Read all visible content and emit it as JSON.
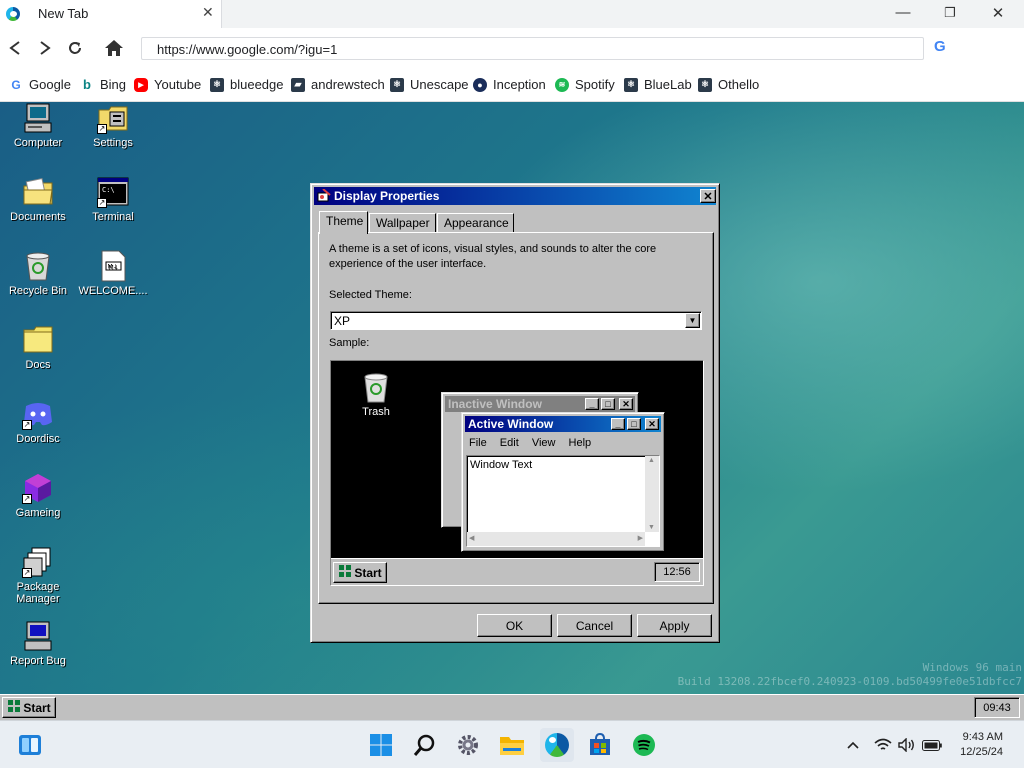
{
  "browser": {
    "tab_title": "New Tab",
    "tab_close": "✕",
    "minimize": "—",
    "restore": "❐",
    "close": "✕",
    "url": "https://www.google.com/?igu=1",
    "google_g": "G",
    "bookmarks": [
      {
        "label": "Google",
        "icon": "google-icon",
        "color": "#4285f4"
      },
      {
        "label": "Bing",
        "icon": "bing-icon",
        "color": "#0c8484"
      },
      {
        "label": "Youtube",
        "icon": "youtube-icon",
        "color": "#ff0000"
      },
      {
        "label": "blueedge",
        "icon": "blueedge-icon",
        "color": "#2b3a4a"
      },
      {
        "label": "andrewstech",
        "icon": "andrewstech-icon",
        "color": "#2b3a4a"
      },
      {
        "label": "Unescape",
        "icon": "unescape-icon",
        "color": "#2b3a4a"
      },
      {
        "label": "Inception",
        "icon": "inception-icon",
        "color": "#1a2d5a"
      },
      {
        "label": "Spotify",
        "icon": "spotify-icon",
        "color": "#1db954"
      },
      {
        "label": "BlueLab",
        "icon": "bluelab-icon",
        "color": "#2b3a4a"
      },
      {
        "label": "Othello",
        "icon": "othello-icon",
        "color": "#2b3a4a"
      }
    ]
  },
  "desktop": {
    "icons": [
      {
        "label": "Computer"
      },
      {
        "label": "Settings"
      },
      {
        "label": "Documents"
      },
      {
        "label": "Terminal"
      },
      {
        "label": "Recycle Bin"
      },
      {
        "label": "WELCOME...."
      },
      {
        "label": "Docs"
      },
      {
        "label": "Doordisc"
      },
      {
        "label": "Gameing"
      },
      {
        "label": "Package Manager"
      },
      {
        "label": "Report Bug"
      }
    ],
    "build_line1": "Windows 96 main",
    "build_line2": "Build 13208.22fbcef0.240923-0109.bd50499fe0e51dbfcc7"
  },
  "dialog": {
    "title": "Display Properties",
    "close": "✕",
    "tabs": [
      "Theme",
      "Wallpaper",
      "Appearance"
    ],
    "description": "A theme is a set of icons, visual styles, and sounds to alter the core experience of the user interface.",
    "selected_theme_label": "Selected Theme:",
    "selected_theme": "XP",
    "sample_label": "Sample:",
    "sample": {
      "trash_label": "Trash",
      "inactive_title": "Inactive Window",
      "active_title": "Active Window",
      "menu": [
        "File",
        "Edit",
        "View",
        "Help"
      ],
      "window_text": "Window Text",
      "start": "Start",
      "clock": "12:56"
    },
    "ok": "OK",
    "cancel": "Cancel",
    "apply": "Apply"
  },
  "w96_taskbar": {
    "start": "Start",
    "clock": "09:43"
  },
  "w11_taskbar": {
    "time": "9:43 AM",
    "date": "12/25/24"
  }
}
